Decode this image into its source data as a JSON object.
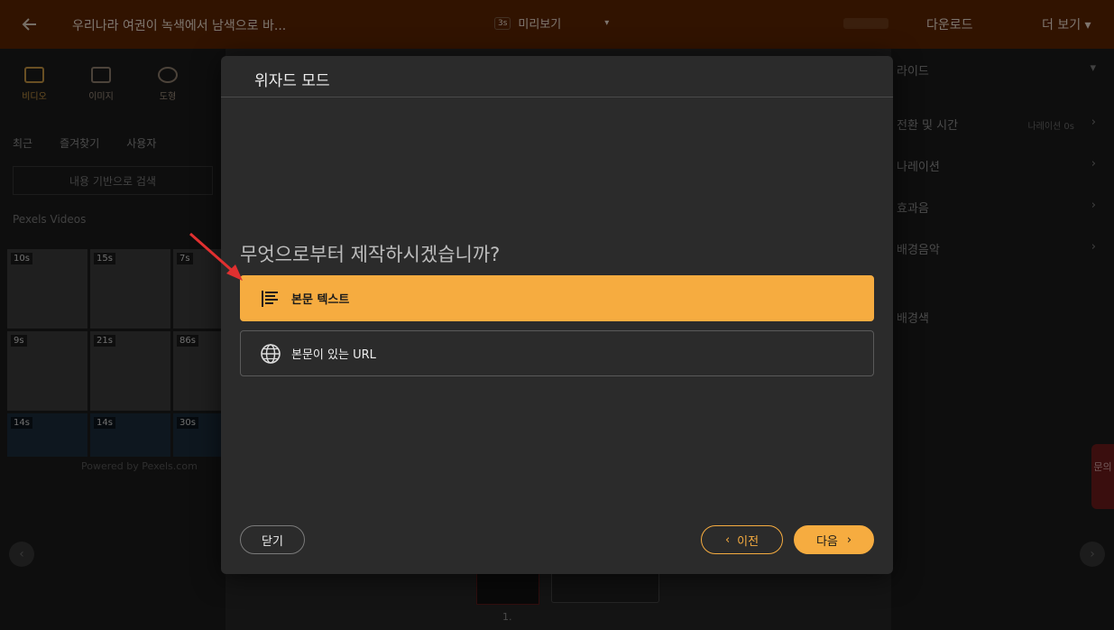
{
  "app": {
    "title": "우리나라 여권이 녹색에서 남색으로 바...",
    "preview_badge": "3s",
    "preview_label": "미리보기",
    "download_label": "다운로드",
    "more_label": "더 보기"
  },
  "left_panel": {
    "tools": [
      {
        "label": "비디오",
        "icon": "video-icon"
      },
      {
        "label": "이미지",
        "icon": "image-icon"
      },
      {
        "label": "도형",
        "icon": "shape-icon"
      }
    ],
    "subtabs": [
      "최근",
      "즐겨찾기",
      "사용자"
    ],
    "search_label": "내용 기반으로 검색",
    "source_label": "Pexels Videos",
    "thumbnails": [
      "10s",
      "15s",
      "7s",
      "9s",
      "21s",
      "86s",
      "14s",
      "14s",
      "30s"
    ],
    "powered_by": "Powered by Pexels.com"
  },
  "right_panel": {
    "header": "라이드",
    "items": [
      {
        "label": "전환 및 시간",
        "sub": "나레이션 0s"
      },
      {
        "label": "나레이션",
        "sub": ""
      },
      {
        "label": "효과음",
        "sub": ""
      },
      {
        "label": "배경음악",
        "sub": ""
      }
    ],
    "color_label": "배경색",
    "side_tab": "문의"
  },
  "timeline": {
    "slide_number": "1."
  },
  "modal": {
    "title": "위자드 모드",
    "question": "무엇으로부터 제작하시겠습니까?",
    "options": [
      {
        "label": "본문 텍스트",
        "icon": "text-lines-icon",
        "selected": true
      },
      {
        "label": "본문이 있는 URL",
        "icon": "globe-icon",
        "selected": false
      }
    ],
    "close_label": "닫기",
    "prev_label": "이전",
    "next_label": "다음"
  },
  "colors": {
    "accent": "#f6ac40",
    "topbar": "#5a2400",
    "modal_bg": "#2b2b2b",
    "annotation_arrow": "#e03030"
  }
}
